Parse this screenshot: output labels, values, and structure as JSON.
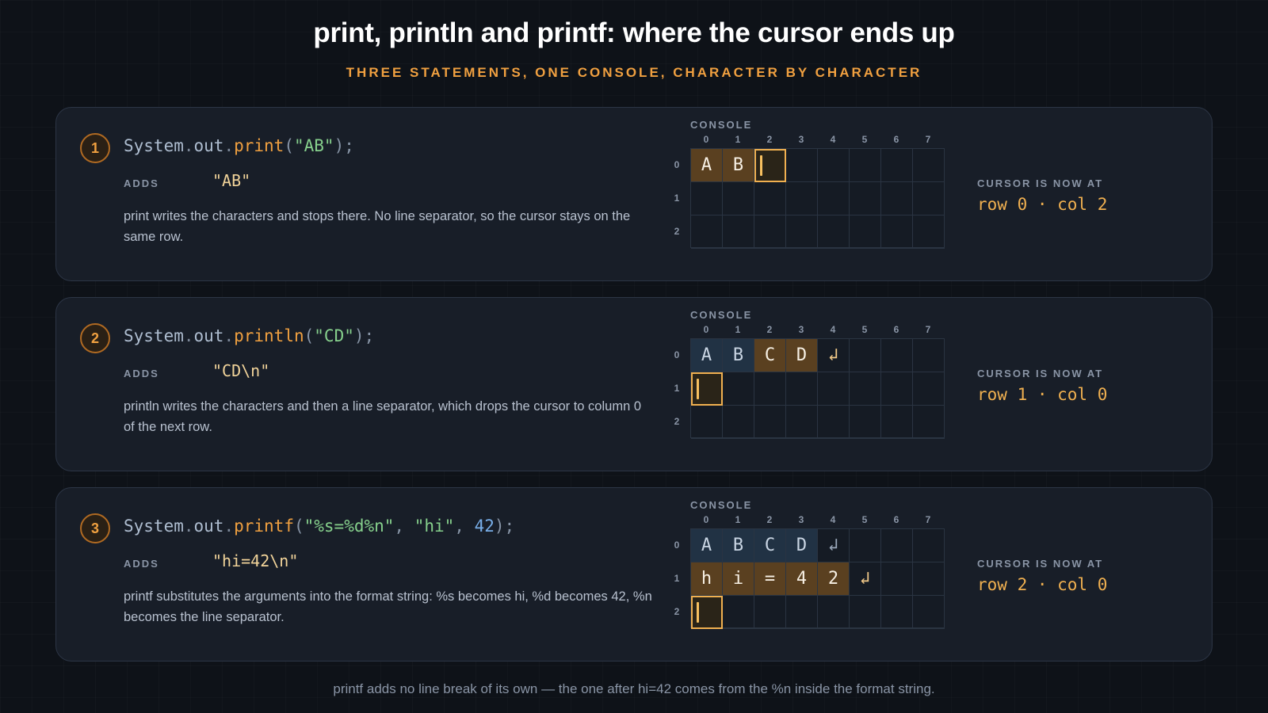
{
  "title": "print, println and printf: where the cursor ends up",
  "subtitle": "THREE STATEMENTS, ONE CONSOLE, CHARACTER BY CHARACTER",
  "colors": {
    "accent": "#f0a040",
    "string": "#86d08c",
    "number": "#78aee8",
    "new_cell": "#5a4020",
    "old_cell": "#213244",
    "cursor": "#f0b050"
  },
  "labels": {
    "adds": "ADDS",
    "console": "CONSOLE",
    "cursor_is_now_at": "CURSOR IS NOW AT"
  },
  "col_indices": [
    "0",
    "1",
    "2",
    "3",
    "4",
    "5",
    "6",
    "7"
  ],
  "row_indices": [
    "0",
    "1",
    "2"
  ],
  "newline_glyph": "↲",
  "steps": [
    {
      "number": "1",
      "code": {
        "obj1": "System",
        "dot1": ".",
        "obj2": "out",
        "dot2": ".",
        "method": "print",
        "open": "(",
        "arg1": "\"AB\"",
        "close": ");"
      },
      "adds": "\"AB\"",
      "description": "print writes the characters and stops there. No line separator, so the cursor stays on the same row.",
      "cursor_text": "row 0 · col 2",
      "cursor": {
        "row": 0,
        "col": 2
      },
      "cells": [
        {
          "row": 0,
          "col": 0,
          "char": "A",
          "state": "new"
        },
        {
          "row": 0,
          "col": 1,
          "char": "B",
          "state": "new"
        }
      ]
    },
    {
      "number": "2",
      "code": {
        "obj1": "System",
        "dot1": ".",
        "obj2": "out",
        "dot2": ".",
        "method": "println",
        "open": "(",
        "arg1": "\"CD\"",
        "close": ");"
      },
      "adds": "\"CD\\n\"",
      "description": "println writes the characters and then a line separator, which drops the cursor to column 0 of the next row.",
      "cursor_text": "row 1 · col 0",
      "cursor": {
        "row": 1,
        "col": 0
      },
      "cells": [
        {
          "row": 0,
          "col": 0,
          "char": "A",
          "state": "old"
        },
        {
          "row": 0,
          "col": 1,
          "char": "B",
          "state": "old"
        },
        {
          "row": 0,
          "col": 2,
          "char": "C",
          "state": "new"
        },
        {
          "row": 0,
          "col": 3,
          "char": "D",
          "state": "new"
        },
        {
          "row": 0,
          "col": 4,
          "char": "↲",
          "state": "nl-new"
        }
      ]
    },
    {
      "number": "3",
      "code": {
        "obj1": "System",
        "dot1": ".",
        "obj2": "out",
        "dot2": ".",
        "method": "printf",
        "open": "(",
        "arg1": "\"%s=%d%n\"",
        "sep1": ", ",
        "arg2": "\"hi\"",
        "sep2": ", ",
        "arg3": "42",
        "close": ");"
      },
      "adds": "\"hi=42\\n\"",
      "description": "printf substitutes the arguments into the format string: %s becomes hi, %d becomes 42, %n becomes the line separator.",
      "cursor_text": "row 2 · col 0",
      "cursor": {
        "row": 2,
        "col": 0
      },
      "cells": [
        {
          "row": 0,
          "col": 0,
          "char": "A",
          "state": "old"
        },
        {
          "row": 0,
          "col": 1,
          "char": "B",
          "state": "old"
        },
        {
          "row": 0,
          "col": 2,
          "char": "C",
          "state": "old"
        },
        {
          "row": 0,
          "col": 3,
          "char": "D",
          "state": "old"
        },
        {
          "row": 0,
          "col": 4,
          "char": "↲",
          "state": "nl-old"
        },
        {
          "row": 1,
          "col": 0,
          "char": "h",
          "state": "new"
        },
        {
          "row": 1,
          "col": 1,
          "char": "i",
          "state": "new"
        },
        {
          "row": 1,
          "col": 2,
          "char": "=",
          "state": "new"
        },
        {
          "row": 1,
          "col": 3,
          "char": "4",
          "state": "new"
        },
        {
          "row": 1,
          "col": 4,
          "char": "2",
          "state": "new"
        },
        {
          "row": 1,
          "col": 5,
          "char": "↲",
          "state": "nl-new"
        }
      ]
    }
  ],
  "footer": "printf adds no line break of its own — the one after hi=42 comes from the %n inside the format string."
}
